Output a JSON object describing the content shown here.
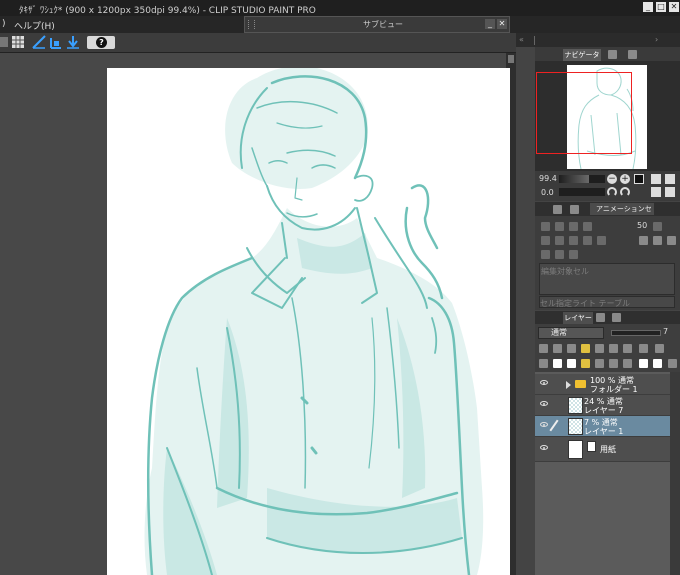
{
  "window": {
    "title": "ﾀｷｻﾞ ﾜｼｭｸ* (900 x 1200px 350dpi 99.4%) - CLIP STUDIO PAINT PRO",
    "minimize": "_",
    "maximize": "□",
    "close": "✕"
  },
  "menu": {
    "item_partial": ")",
    "help": "ヘルプ(H)"
  },
  "subview": {
    "title": "サブビュー",
    "minimize": "_",
    "close": "✕"
  },
  "toolbar": {
    "help_label": "?"
  },
  "panels": {
    "navigator": {
      "tab_label": "ナビゲーター",
      "zoom": "99.4",
      "angle": "0.0"
    },
    "animation": {
      "tab_label": "アニメーションセル",
      "frame_value": "50",
      "field1": "編集対象セル",
      "field2": "セル指定ライト テーブル"
    },
    "layers": {
      "tab_label": "レイヤー",
      "blend_mode": "通常",
      "opacity": "7",
      "items": [
        {
          "line1": "100 % 通常",
          "line2": "フォルダー 1",
          "type": "folder",
          "selected": false
        },
        {
          "line1": "24 % 通常",
          "line2": "レイヤー 7",
          "type": "raster",
          "selected": false
        },
        {
          "line1": "7 % 通常",
          "line2": "レイヤー 1",
          "type": "raster",
          "selected": true
        },
        {
          "line1": "用紙",
          "line2": "",
          "type": "paper",
          "selected": false
        }
      ]
    }
  },
  "colors": {
    "sketch": "#7cc8c0",
    "fill": "#d8eeeb",
    "selection": "#6a8aa0",
    "nav_rect": "#e22222"
  }
}
